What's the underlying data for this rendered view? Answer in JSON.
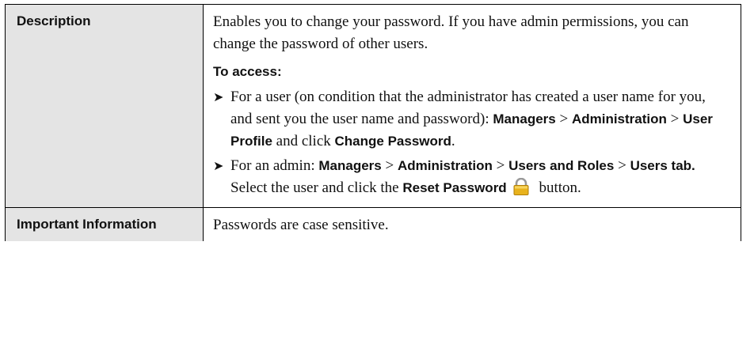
{
  "rows": [
    {
      "label": "Description",
      "intro": "Enables you to change your password. If you have admin permissions, you can change the password of other users.",
      "access_heading": "To access:",
      "bullets": [
        {
          "arrow": "➤",
          "text_start": "For a user (on condition that the administrator has created a user name for you, and sent you the user name and password): ",
          "ui1": "Managers",
          "sep1": " > ",
          "ui2": "Administration",
          "sep2": " > ",
          "ui3": "User Profile",
          "text_mid": " and click ",
          "ui4": "Change Password",
          "text_end": "."
        },
        {
          "arrow": "➤",
          "text_start": "For an admin: ",
          "ui1": "Managers",
          "sep1": " > ",
          "ui2": "Administration",
          "sep2": " > ",
          "ui3": "Users and Roles",
          "sep3": " > ",
          "ui4": "Users tab.",
          "text_mid": " Select the user and click the ",
          "ui5": "Reset Password",
          "icon": "lock-icon",
          "text_end": " button."
        }
      ]
    },
    {
      "label": "Important Information",
      "text": "Passwords are case sensitive."
    }
  ],
  "colors": {
    "label_bg": "#e4e4e4",
    "border": "#000000",
    "lock_body": "#e8b21c"
  }
}
